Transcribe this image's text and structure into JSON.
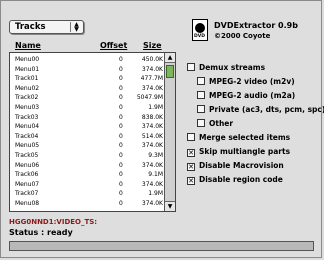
{
  "popup": {
    "selected": "Tracks"
  },
  "columns": {
    "name": "Name",
    "offset": "Offset",
    "size": "Size"
  },
  "rows": [
    {
      "name": "Menu00",
      "offset": "0",
      "size": "450.0K"
    },
    {
      "name": "Menu01",
      "offset": "0",
      "size": "374.0K"
    },
    {
      "name": "Track01",
      "offset": "0",
      "size": "477.7M"
    },
    {
      "name": "Menu02",
      "offset": "0",
      "size": "374.0K"
    },
    {
      "name": "Track02",
      "offset": "0",
      "size": "5047.9M"
    },
    {
      "name": "Menu03",
      "offset": "0",
      "size": "1.9M"
    },
    {
      "name": "Track03",
      "offset": "0",
      "size": "838.0K"
    },
    {
      "name": "Menu04",
      "offset": "0",
      "size": "374.0K"
    },
    {
      "name": "Track04",
      "offset": "0",
      "size": "514.0K"
    },
    {
      "name": "Menu05",
      "offset": "0",
      "size": "374.0K"
    },
    {
      "name": "Track05",
      "offset": "0",
      "size": "9.3M"
    },
    {
      "name": "Menu06",
      "offset": "0",
      "size": "374.0K"
    },
    {
      "name": "Track06",
      "offset": "0",
      "size": "9.1M"
    },
    {
      "name": "Menu07",
      "offset": "0",
      "size": "374.0K"
    },
    {
      "name": "Track07",
      "offset": "0",
      "size": "1.9M"
    },
    {
      "name": "Menu08",
      "offset": "0",
      "size": "374.0K"
    }
  ],
  "app": {
    "title": "DVDExtractor 0.9b",
    "copyright": "©2000 Coyote",
    "logo_text": "DVD"
  },
  "options": {
    "demux": "Demux streams",
    "mpeg2_video": "MPEG-2 video (m2v)",
    "mpeg2_audio": "MPEG-2 audio (m2a)",
    "private": "Private (ac3, dts, pcm, spc)",
    "other": "Other",
    "merge": "Merge selected items",
    "skip": "Skip multiangle parts",
    "macrovision": "Disable Macrovision",
    "region": "Disable region code"
  },
  "option_checked": {
    "demux": false,
    "mpeg2_video": false,
    "mpeg2_audio": false,
    "private": false,
    "other": false,
    "merge": false,
    "skip": true,
    "macrovision": true,
    "region": true
  },
  "path": "HGG0NND1:VIDEO_TS:",
  "status": "Status : ready",
  "progress": 0.0,
  "colors": {
    "path": "#8b1a1a",
    "thumb": "#7fb45f"
  }
}
